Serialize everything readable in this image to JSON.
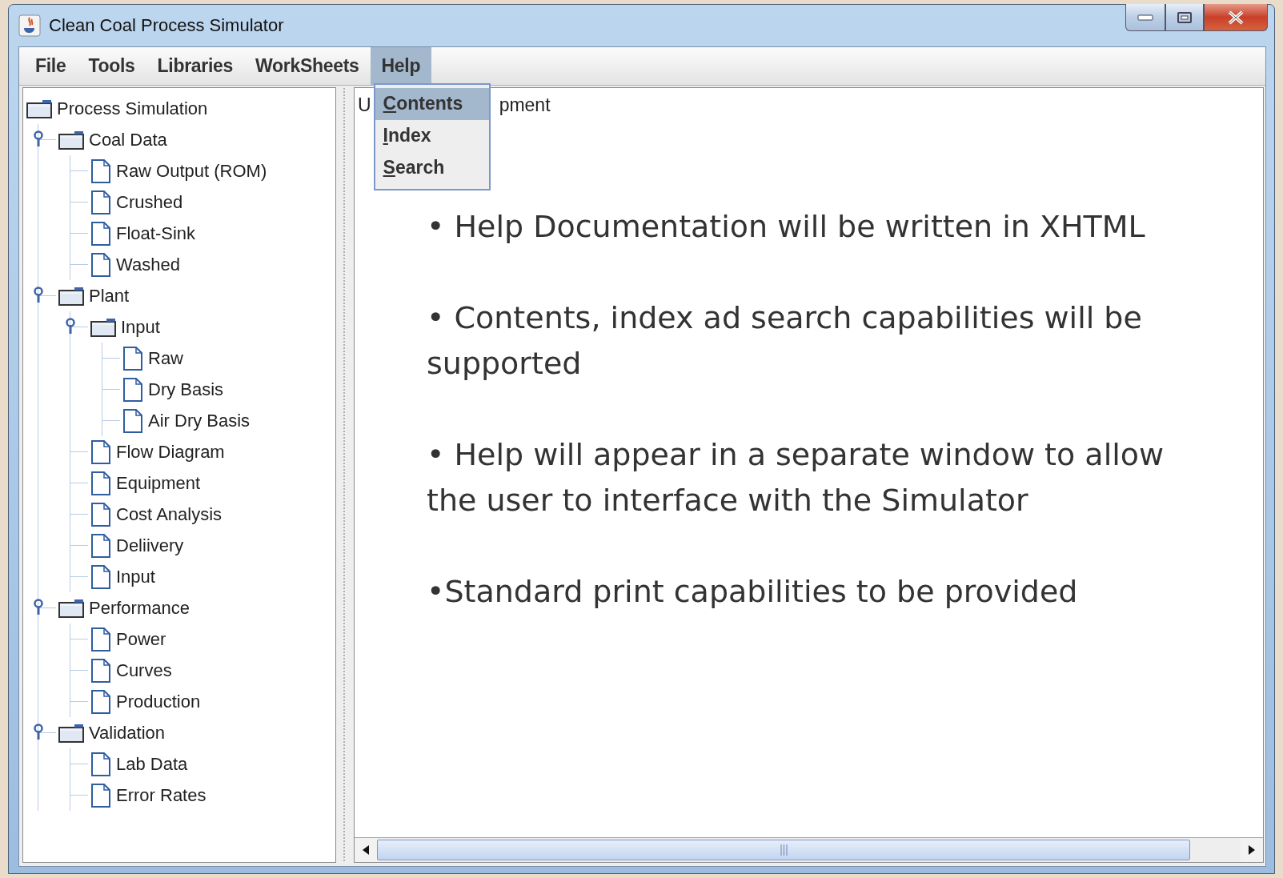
{
  "window": {
    "title": "Clean Coal Process Simulator"
  },
  "menu_bar": [
    {
      "label": "File",
      "selected": false
    },
    {
      "label": "Tools",
      "selected": false
    },
    {
      "label": "Libraries",
      "selected": false
    },
    {
      "label": "WorkSheets",
      "selected": false
    },
    {
      "label": "Help",
      "selected": true
    }
  ],
  "help_menu": [
    {
      "label": "Contents",
      "selected": true
    },
    {
      "label": "Index",
      "selected": false
    },
    {
      "label": "Search",
      "selected": false
    }
  ],
  "tree": {
    "label": "Process Simulation",
    "kind": "folder",
    "children": [
      {
        "label": "Coal Data",
        "kind": "folder",
        "expanded": true,
        "children": [
          {
            "label": "Raw Output (ROM)",
            "kind": "page"
          },
          {
            "label": "Crushed",
            "kind": "page"
          },
          {
            "label": "Float-Sink",
            "kind": "page"
          },
          {
            "label": "Washed",
            "kind": "page"
          }
        ]
      },
      {
        "label": "Plant",
        "kind": "folder",
        "expanded": true,
        "children": [
          {
            "label": "Input",
            "kind": "folder",
            "expanded": true,
            "children": [
              {
                "label": "Raw",
                "kind": "page"
              },
              {
                "label": "Dry Basis",
                "kind": "page"
              },
              {
                "label": "Air Dry Basis",
                "kind": "page"
              }
            ]
          },
          {
            "label": "Flow Diagram",
            "kind": "page"
          },
          {
            "label": "Equipment",
            "kind": "page"
          },
          {
            "label": "Cost Analysis",
            "kind": "page"
          },
          {
            "label": "Deliivery",
            "kind": "page"
          },
          {
            "label": "Input",
            "kind": "page"
          }
        ]
      },
      {
        "label": "Performance",
        "kind": "folder",
        "expanded": true,
        "children": [
          {
            "label": "Power",
            "kind": "page"
          },
          {
            "label": "Curves",
            "kind": "page"
          },
          {
            "label": "Production",
            "kind": "page"
          }
        ]
      },
      {
        "label": "Validation",
        "kind": "folder",
        "expanded": true,
        "children": [
          {
            "label": "Lab Data",
            "kind": "page"
          },
          {
            "label": "Error Rates",
            "kind": "page"
          }
        ]
      }
    ]
  },
  "content": {
    "heading_left": "U",
    "heading_right": "pment",
    "bullets": [
      "• Help Documentation will be written in XHTML",
      "• Contents, index ad search capabilities will be supported",
      "• Help will appear in a separate window to allow the user to interface with the Simulator",
      "•Standard print capabilities to be provided"
    ]
  }
}
